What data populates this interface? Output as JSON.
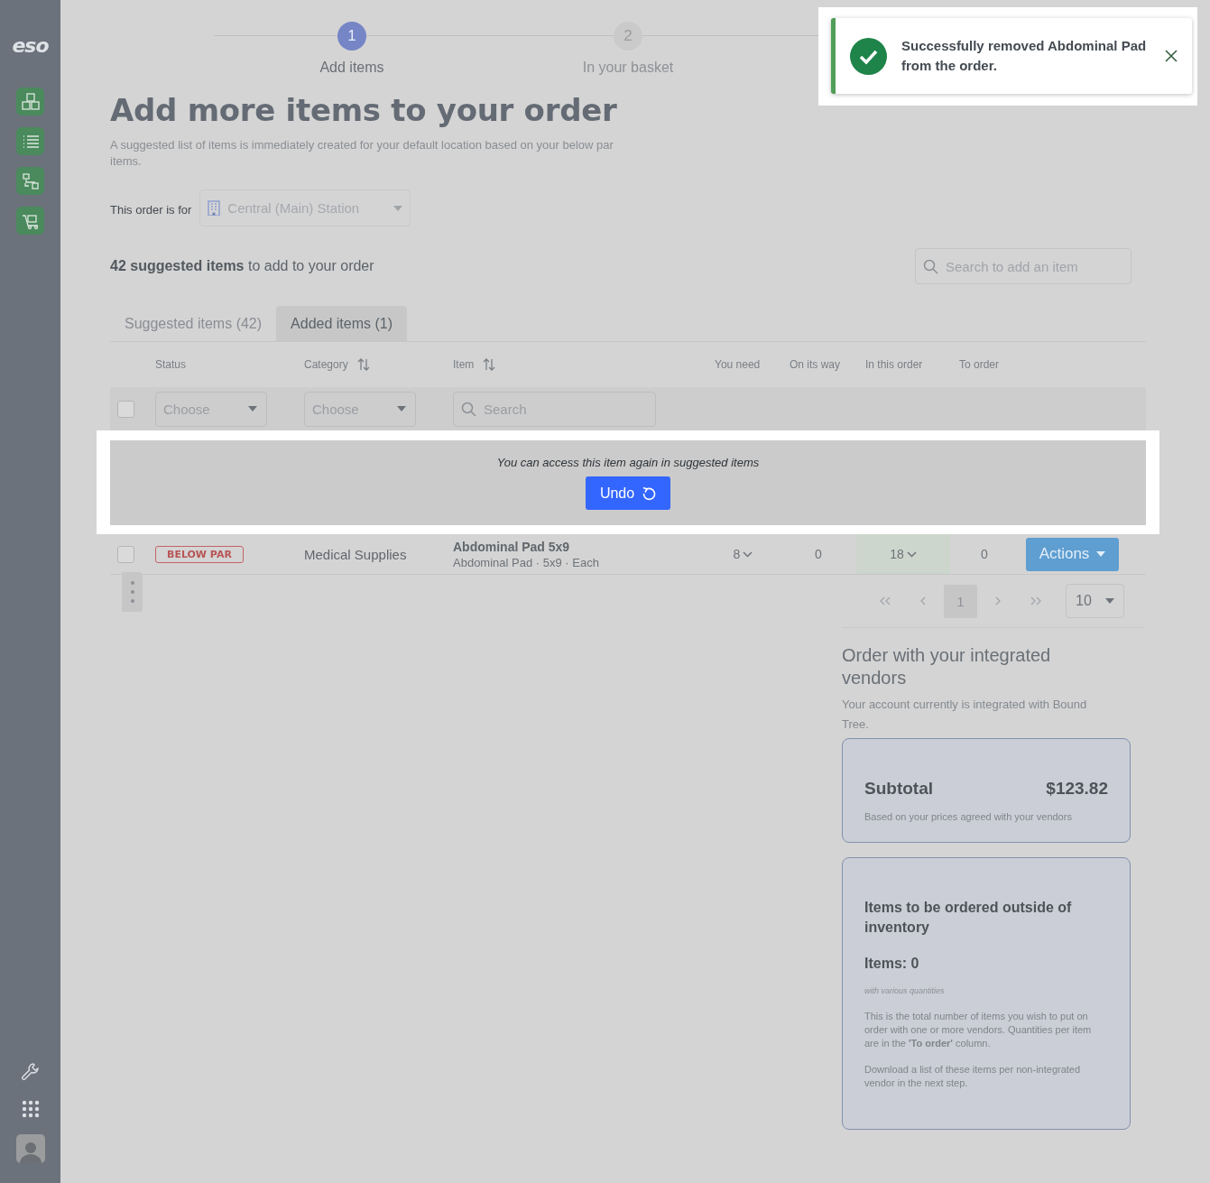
{
  "sidebar": {
    "logo": "eso"
  },
  "stepper": [
    {
      "number": "1",
      "label": "Add items",
      "active": true
    },
    {
      "number": "2",
      "label": "In your basket",
      "active": false
    }
  ],
  "toast": {
    "message": "Successfully removed Abdominal Pad from the order."
  },
  "page": {
    "title": "Add more items to your order",
    "description": "A suggested list of items is immediately created for your default location based on your below par items.",
    "location_label": "This order is for",
    "location_value": "Central (Main) Station",
    "summary": "**42 suggested items** to add to your order",
    "search_placeholder": "Search to add an item"
  },
  "tabs": [
    {
      "label": "Suggested items (42)",
      "selected": false
    },
    {
      "label": "Added items (1)",
      "selected": true
    }
  ],
  "table": {
    "columns": [
      {
        "label": "Status",
        "sortable": false
      },
      {
        "label": "Category",
        "sortable": true
      },
      {
        "label": "Item",
        "sortable": true
      },
      {
        "label": "You need",
        "sortable": false
      },
      {
        "label": "On its way",
        "sortable": false
      },
      {
        "label": "In this order",
        "sortable": false
      },
      {
        "label": "To order",
        "sortable": false
      }
    ],
    "filters": {
      "status": "Choose",
      "category": "Choose",
      "item_placeholder": "Search",
      "all_checked": false
    },
    "undo_banner": {
      "message": "You can access this item again in suggested items",
      "button": "Undo"
    },
    "rows": [
      {
        "checked": false,
        "status": "BELOW PAR",
        "category": "Medical Supplies",
        "item_name": "Abdominal Pad 5x9",
        "item_detail": "Abdominal Pad · 5x9 · Each",
        "you_need": "8",
        "on_its_way": "0",
        "in_this_order": "18",
        "to_order": "0",
        "action": "Actions"
      }
    ]
  },
  "pagination": {
    "pages": [
      {
        "label": "1",
        "selected": true
      }
    ],
    "page_size": "10"
  },
  "vendors": {
    "title": "Order with your integrated vendors",
    "description": "Your account currently is integrated with Bound Tree.",
    "subtotal_label": "Subtotal",
    "subtotal_value": "$123.82",
    "subtotal_note": "Based on your prices agreed with your vendors",
    "outside_title": "Items to be ordered outside of inventory",
    "outside_count": "Items: 0",
    "outside_hint": "with various quantities",
    "outside_text_1": "This is the total number of items you wish to put on order with one or more vendors. Quantities per item are in the **'To order'** column.",
    "outside_text_2": "Download a list of these items per non-integrated vendor in the next step."
  }
}
